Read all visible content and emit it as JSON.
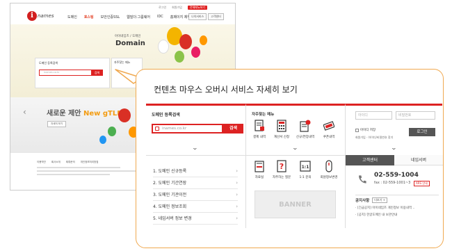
{
  "background_site": {
    "top_links": [
      "로그인",
      "회원가입",
      "전체메뉴보기"
    ],
    "logo_text": "names",
    "nav": [
      "도메인",
      "호스팅",
      "보안인증SSL",
      "웹빌더·그룹웨어",
      "IDC",
      "홈페이지 제작"
    ],
    "nav_buttons": [
      "나의서비스",
      "고객센터"
    ],
    "hero_subtitle": "아이네임즈 / 도메인",
    "hero_title": "Domain",
    "search_title": "도메인 등록검색",
    "search_placeholder": "inames.co.kr",
    "search_button": "검색",
    "fav_title": "자주찾는 메뉴",
    "banner_text_prefix": "새로운 제안",
    "banner_text_highlight": "New gTLD",
    "banner_more": "자세히 보기",
    "footer_tabs": [
      "이용약관",
      "회사소개",
      "제휴문의",
      "개인정보처리방침"
    ]
  },
  "callout": {
    "title": "컨텐츠 마우스 오버시 서비스 자세히 보기",
    "domain_search": {
      "title": "도메인 등록검색",
      "placeholder": "inames.co.kr",
      "button": "검색"
    },
    "domain_menu": [
      {
        "label": "1. 도메인 신규등록",
        "go": "›"
      },
      {
        "label": "2. 도메인 기간연장",
        "go": "›"
      },
      {
        "label": "3. 도메인 기관이전",
        "go": "›"
      },
      {
        "label": "4. 도메인 정보조회",
        "go": "›"
      },
      {
        "label": "5. 네임서버 정보 변경",
        "go": "›"
      }
    ],
    "favorite": {
      "title": "자주찾는 메뉴",
      "items": [
        {
          "label": "결제 내역",
          "icon": "payment-icon"
        },
        {
          "label": "계산서 신청",
          "icon": "calculator-icon"
        },
        {
          "label": "신규/연장내역",
          "icon": "document-icon"
        },
        {
          "label": "쿠폰내역",
          "icon": "coupon-icon"
        },
        {
          "label": "자료실",
          "icon": "archive-icon"
        },
        {
          "label": "자주하는 질문",
          "icon": "faq-icon"
        },
        {
          "label": "1:1 문의",
          "icon": "one-to-one-icon"
        },
        {
          "label": "회원정보변경",
          "icon": "member-info-icon"
        }
      ],
      "banner": "BANNER"
    },
    "login": {
      "id_placeholder": "아이디",
      "pw_placeholder": "비밀번호",
      "remember": "아이디 저장",
      "links": "회원가입 · 아이디/비밀번호 찾기",
      "button": "로그인"
    },
    "support": {
      "tab_active": "고객센터",
      "tab_other": "네임서버",
      "phone": "02-559-1004",
      "fax": "fax : 02-559-1001~3",
      "badge": "ARS 안내"
    },
    "notice": {
      "title": "공지사항",
      "more": "더보기 +",
      "items": [
        "· [긴급공지] 아이네임즈 개인정보 이용내역 ..",
        "· [공지] 한글도메인 내 보관안내"
      ]
    }
  },
  "colors": {
    "accent": "#dd2222",
    "callout_border": "#f0a950"
  }
}
